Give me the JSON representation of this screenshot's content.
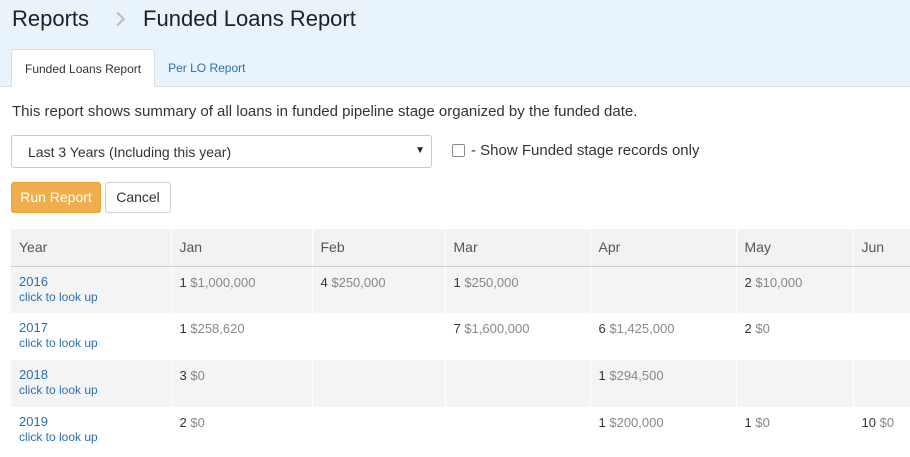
{
  "breadcrumb": {
    "root": "Reports",
    "current": "Funded Loans Report"
  },
  "tabs": [
    {
      "label": "Funded Loans Report",
      "active": true
    },
    {
      "label": "Per LO Report",
      "active": false
    }
  ],
  "description": "This report shows summary of all loans in funded pipeline stage organized by the funded date.",
  "filter": {
    "range_selected": "Last 3 Years (Including this year)",
    "checkbox_label": "- Show Funded stage records only",
    "checkbox_checked": false
  },
  "buttons": {
    "run": "Run Report",
    "cancel": "Cancel"
  },
  "colors": {
    "run_button": "#f0ad4e",
    "link": "#2a6fb0",
    "header_bg": "#e9f3fc"
  },
  "table": {
    "columns": [
      "Year",
      "Jan",
      "Feb",
      "Mar",
      "Apr",
      "May",
      "Jun"
    ],
    "link_label": "click to look up",
    "rows": [
      {
        "year": "2016",
        "cells": [
          {
            "count": "1",
            "amount": "$1,000,000"
          },
          {
            "count": "4",
            "amount": "$250,000"
          },
          {
            "count": "1",
            "amount": "$250,000"
          },
          {
            "count": "",
            "amount": ""
          },
          {
            "count": "2",
            "amount": "$10,000"
          },
          {
            "count": "",
            "amount": ""
          }
        ]
      },
      {
        "year": "2017",
        "cells": [
          {
            "count": "1",
            "amount": "$258,620"
          },
          {
            "count": "",
            "amount": ""
          },
          {
            "count": "7",
            "amount": "$1,600,000"
          },
          {
            "count": "6",
            "amount": "$1,425,000"
          },
          {
            "count": "2",
            "amount": "$0"
          },
          {
            "count": "",
            "amount": ""
          }
        ]
      },
      {
        "year": "2018",
        "cells": [
          {
            "count": "3",
            "amount": "$0"
          },
          {
            "count": "",
            "amount": ""
          },
          {
            "count": "",
            "amount": ""
          },
          {
            "count": "1",
            "amount": "$294,500"
          },
          {
            "count": "",
            "amount": ""
          },
          {
            "count": "",
            "amount": ""
          }
        ]
      },
      {
        "year": "2019",
        "cells": [
          {
            "count": "2",
            "amount": "$0"
          },
          {
            "count": "",
            "amount": ""
          },
          {
            "count": "",
            "amount": ""
          },
          {
            "count": "1",
            "amount": "$200,000"
          },
          {
            "count": "1",
            "amount": "$0"
          },
          {
            "count": "10",
            "amount": "$0"
          }
        ]
      }
    ]
  }
}
